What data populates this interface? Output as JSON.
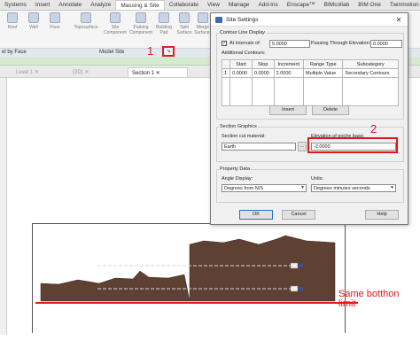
{
  "ribbon": {
    "tabs": [
      "Systems",
      "Insert",
      "Annotate",
      "Analyze",
      "Massing & Site",
      "Collaborate",
      "View",
      "Manage",
      "Add-Ins",
      "Enscape™",
      "BIMcollab",
      "BIM One",
      "Twinmotion"
    ],
    "active_tab": "Massing & Site",
    "buttons": [
      {
        "label": "Roof"
      },
      {
        "label": "Wall"
      },
      {
        "label": "Floor"
      },
      {
        "label": "Toposurface"
      },
      {
        "label": "Site Component"
      },
      {
        "label": "Parking Component"
      },
      {
        "label": "Building Pad"
      },
      {
        "label": "Split Surface"
      },
      {
        "label": "Merge Surfaces"
      }
    ],
    "panel_left_label": "el by Face",
    "panel_model_site": "Model Site",
    "launcher_glyph": "↘"
  },
  "annotations": {
    "marker_1": "1",
    "marker_2": "2",
    "note": "Same botthon limit"
  },
  "view_tabs": [
    {
      "label": "Level 1"
    },
    {
      "label": "{3D}"
    },
    {
      "label": "Section 1"
    }
  ],
  "dialog": {
    "title": "Site Settings",
    "close_glyph": "✕",
    "contour": {
      "group_label": "Contour Line Display",
      "at_intervals_label": "At Intervals of:",
      "at_intervals_checked": true,
      "at_intervals_value": "5.0000",
      "passing_label": "Passing Through Elevation:",
      "passing_value": "0.0000",
      "additional_label": "Additional Contours:",
      "columns": [
        "",
        "Start",
        "Stop",
        "Increment",
        "Range Type",
        "Subcategory"
      ],
      "rows": [
        [
          "1",
          "0.0000",
          "0.0000",
          "2.0000",
          "Multiple Value",
          "Secondary Contours"
        ]
      ],
      "insert_label": "Insert",
      "delete_label": "Delete"
    },
    "section": {
      "group_label": "Section Graphics",
      "cut_material_label": "Section cut material:",
      "cut_material_value": "Earth",
      "browse_label": "...",
      "poche_label": "Elevation of poche base:",
      "poche_value": "-2.0000"
    },
    "property": {
      "group_label": "Property Data",
      "angle_label": "Angle Display:",
      "angle_value": "Degrees from N/S",
      "units_label": "Units:",
      "units_value": "Degrees minutes seconds"
    },
    "ok_label": "OK",
    "cancel_label": "Cancel",
    "help_label": "Help"
  },
  "colors": {
    "earth": "#5e4133",
    "annotation_red": "#e01818",
    "green_strip": "#d6ead0"
  }
}
